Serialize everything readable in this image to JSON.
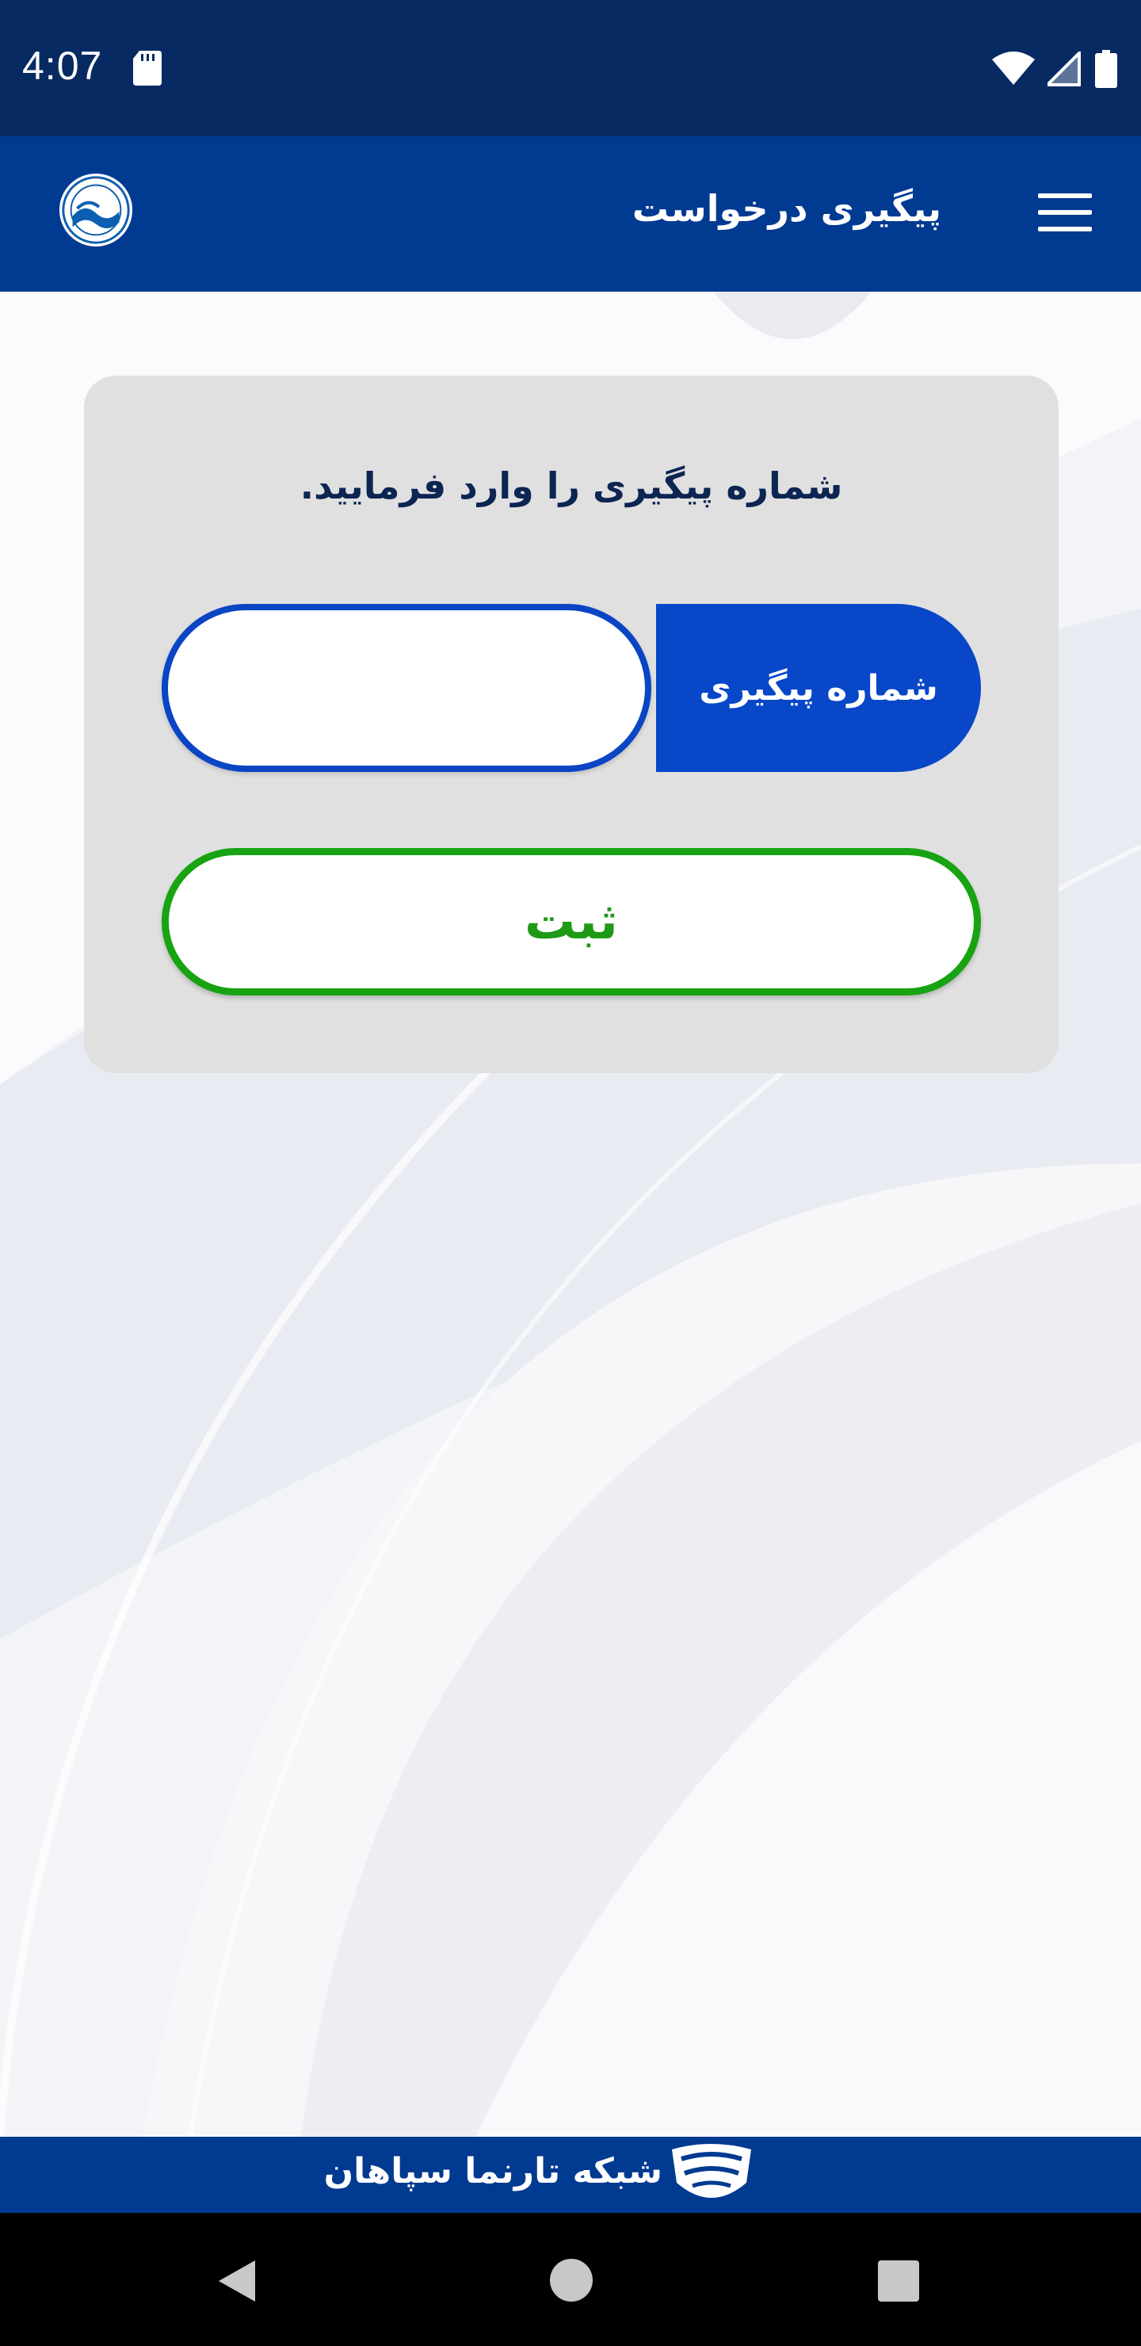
{
  "status_bar": {
    "time": "4:07",
    "icons": [
      "sd-card-icon",
      "wifi-icon",
      "signal-icon",
      "battery-icon"
    ]
  },
  "app_bar": {
    "title": "پیگیری درخواست",
    "menu_icon": "menu-icon",
    "logo": "water-company-logo"
  },
  "form": {
    "heading": "شماره پیگیری را وارد فرمایید.",
    "tracking_label": "شماره پیگیری",
    "tracking_value": "",
    "submit_label": "ثبت"
  },
  "footer": {
    "text": "شبکه تارنما سپاهان",
    "logo": "tarnama-logo"
  },
  "nav_bar": {
    "icons": [
      "back-icon",
      "home-icon",
      "recents-icon"
    ]
  },
  "colors": {
    "status_bar": "#072a63",
    "app_bar": "#003a91",
    "accent_blue": "#0747c8",
    "submit_green": "#18a312",
    "card": "#e0e0e0"
  }
}
